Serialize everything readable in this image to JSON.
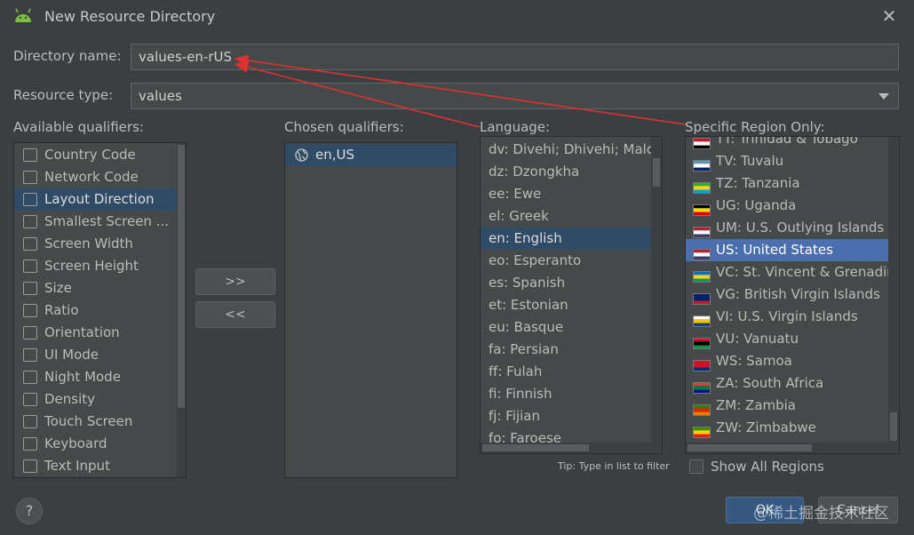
{
  "window": {
    "title": "New Resource Directory",
    "close_glyph": "✕"
  },
  "form": {
    "directory_label": "Directory name:",
    "directory_value": "values-en-rUS",
    "resource_type_label": "Resource type:",
    "resource_type_value": "values"
  },
  "available": {
    "label": "Available qualifiers:",
    "items": [
      {
        "label": "Country Code",
        "icon": "country-code-icon"
      },
      {
        "label": "Network Code",
        "icon": "network-code-icon"
      },
      {
        "label": "Layout Direction",
        "icon": "layout-direction-icon"
      },
      {
        "label": "Smallest Screen ...",
        "icon": "smallest-screen-icon"
      },
      {
        "label": "Screen Width",
        "icon": "screen-width-icon"
      },
      {
        "label": "Screen Height",
        "icon": "screen-height-icon"
      },
      {
        "label": "Size",
        "icon": "size-icon"
      },
      {
        "label": "Ratio",
        "icon": "ratio-icon"
      },
      {
        "label": "Orientation",
        "icon": "orientation-icon"
      },
      {
        "label": "UI Mode",
        "icon": "ui-mode-icon"
      },
      {
        "label": "Night Mode",
        "icon": "night-mode-icon"
      },
      {
        "label": "Density",
        "icon": "density-icon"
      },
      {
        "label": "Touch Screen",
        "icon": "touch-screen-icon"
      },
      {
        "label": "Keyboard",
        "icon": "keyboard-icon"
      },
      {
        "label": "Text Input",
        "icon": "text-input-icon"
      }
    ],
    "selected_index": 2
  },
  "buttons": {
    "add": ">>",
    "remove": "<<"
  },
  "chosen": {
    "label": "Chosen qualifiers:",
    "items": [
      {
        "label": "en,US",
        "icon": "globe-icon"
      }
    ]
  },
  "language": {
    "label": "Language:",
    "items": [
      "dv: Divehi; Dhivehi; Maldivian",
      "dz: Dzongkha",
      "ee: Ewe",
      "el: Greek",
      "en: English",
      "eo: Esperanto",
      "es: Spanish",
      "et: Estonian",
      "eu: Basque",
      "fa: Persian",
      "ff: Fulah",
      "fi: Finnish",
      "fj: Fijian",
      "fo: Faroese"
    ],
    "selected_index": 4,
    "tip": "Tip: Type in list to filter"
  },
  "region": {
    "label": "Specific Region Only:",
    "items": [
      {
        "label": "TT: Trinidad & Tobago",
        "flag": "tt-flag-icon"
      },
      {
        "label": "TV: Tuvalu",
        "flag": "tv-flag-icon"
      },
      {
        "label": "TZ: Tanzania",
        "flag": "tz-flag-icon"
      },
      {
        "label": "UG: Uganda",
        "flag": "ug-flag-icon"
      },
      {
        "label": "UM: U.S. Outlying Islands",
        "flag": "um-flag-icon"
      },
      {
        "label": "US: United States",
        "flag": "us-flag-icon"
      },
      {
        "label": "VC: St. Vincent & Grenadines",
        "flag": "vc-flag-icon"
      },
      {
        "label": "VG: British Virgin Islands",
        "flag": "vg-flag-icon"
      },
      {
        "label": "VI: U.S. Virgin Islands",
        "flag": "vi-flag-icon"
      },
      {
        "label": "VU: Vanuatu",
        "flag": "vu-flag-icon"
      },
      {
        "label": "WS: Samoa",
        "flag": "ws-flag-icon"
      },
      {
        "label": "ZA: South Africa",
        "flag": "za-flag-icon"
      },
      {
        "label": "ZM: Zambia",
        "flag": "zm-flag-icon"
      },
      {
        "label": "ZW: Zimbabwe",
        "flag": "zw-flag-icon"
      }
    ],
    "selected_index": 5,
    "show_all_label": "Show All Regions",
    "show_all_checked": false
  },
  "footer": {
    "help": "?",
    "ok": "OK",
    "cancel": "Cancel",
    "watermark": "@稀土掘金技术社区"
  },
  "colors": {
    "background": "#3c3f41",
    "selection_dark": "#2f4b66",
    "selection_blue": "#4b6eaf",
    "annotation_arrow": "#e03030"
  }
}
